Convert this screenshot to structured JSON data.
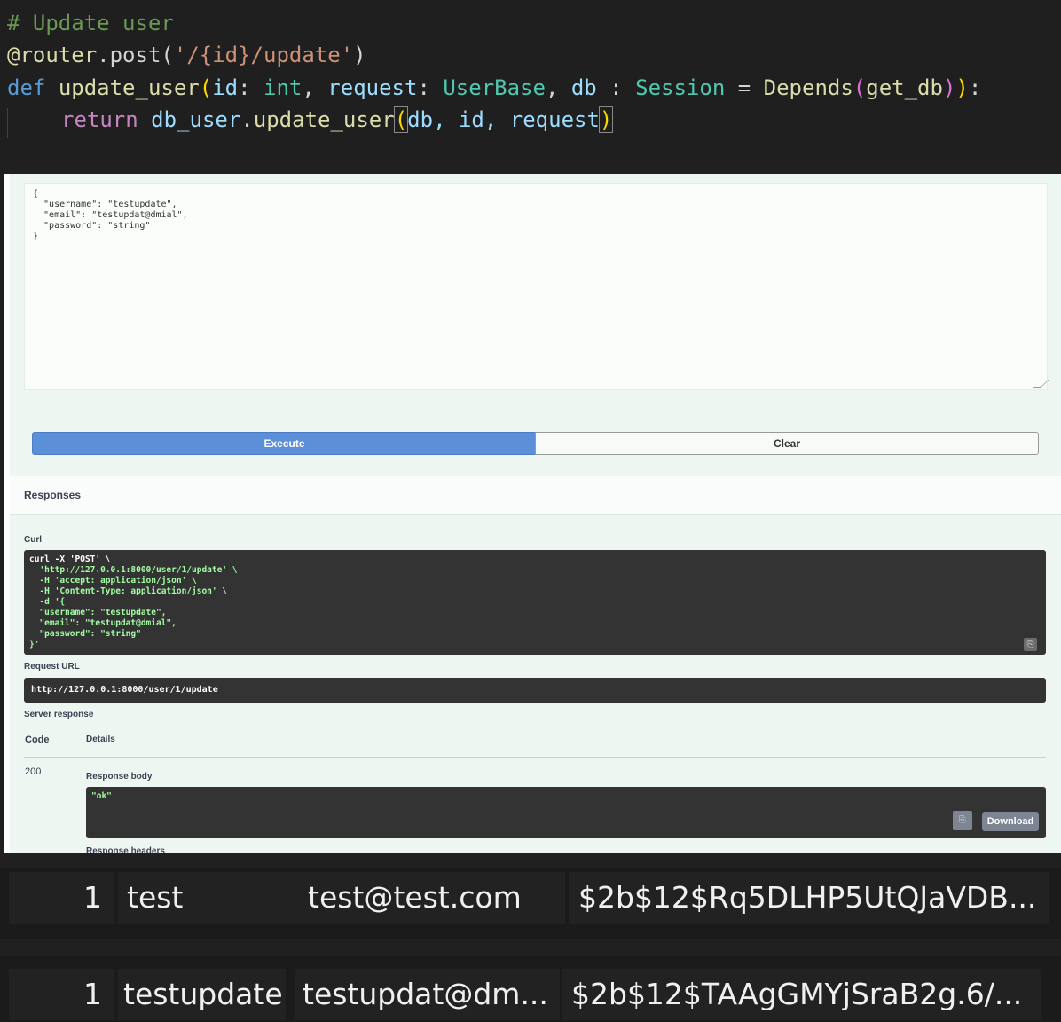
{
  "code_editor": {
    "line1": "# Update user",
    "line2_decorator": "@router",
    "line2_method": ".post(",
    "line2_path": "'/{id}/update'",
    "line2_close": ")",
    "line3_def": "def",
    "line3_fn": "update_user",
    "line3_p1": "id",
    "line3_t1": "int",
    "line3_p2": "request",
    "line3_t2": "UserBase",
    "line3_p3": "db",
    "line3_t3": "Session",
    "line3_dep": "Depends",
    "line3_arg": "get_db",
    "line4_return": "return",
    "line4_obj": "db_user",
    "line4_fn": "update_user",
    "line4_args": "db, id, request"
  },
  "swagger": {
    "request_body": "{\n  \"username\": \"testupdate\",\n  \"email\": \"testupdat@dmial\",\n  \"password\": \"string\"\n}",
    "execute_label": "Execute",
    "clear_label": "Clear",
    "responses_title": "Responses",
    "curl_label": "Curl",
    "curl_text": "curl -X 'POST' \\\n  'http://127.0.0.1:8000/user/1/update' \\\n  -H 'accept: application/json' \\\n  -H 'Content-Type: application/json' \\\n  -d '{\n  \"username\": \"testupdate\",\n  \"email\": \"testupdat@dmial\",\n  \"password\": \"string\"\n}'",
    "request_url_label": "Request URL",
    "request_url": "http://127.0.0.1:8000/user/1/update",
    "server_response_label": "Server response",
    "code_header": "Code",
    "details_header": "Details",
    "status_code": "200",
    "response_body_label": "Response body",
    "response_body": "\"ok\"",
    "download_label": "Download",
    "response_headers_label": "Response headers"
  },
  "db_rows": [
    {
      "id": "1",
      "username": "test",
      "email": "test@test.com",
      "password": "$2b$12$Rq5DLHP5UtQJaVDB..."
    },
    {
      "id": "1",
      "username": "testupdate",
      "email": "testupdat@dm...",
      "password": "$2b$12$TAAgGMYjSraB2g.6/..."
    }
  ]
}
